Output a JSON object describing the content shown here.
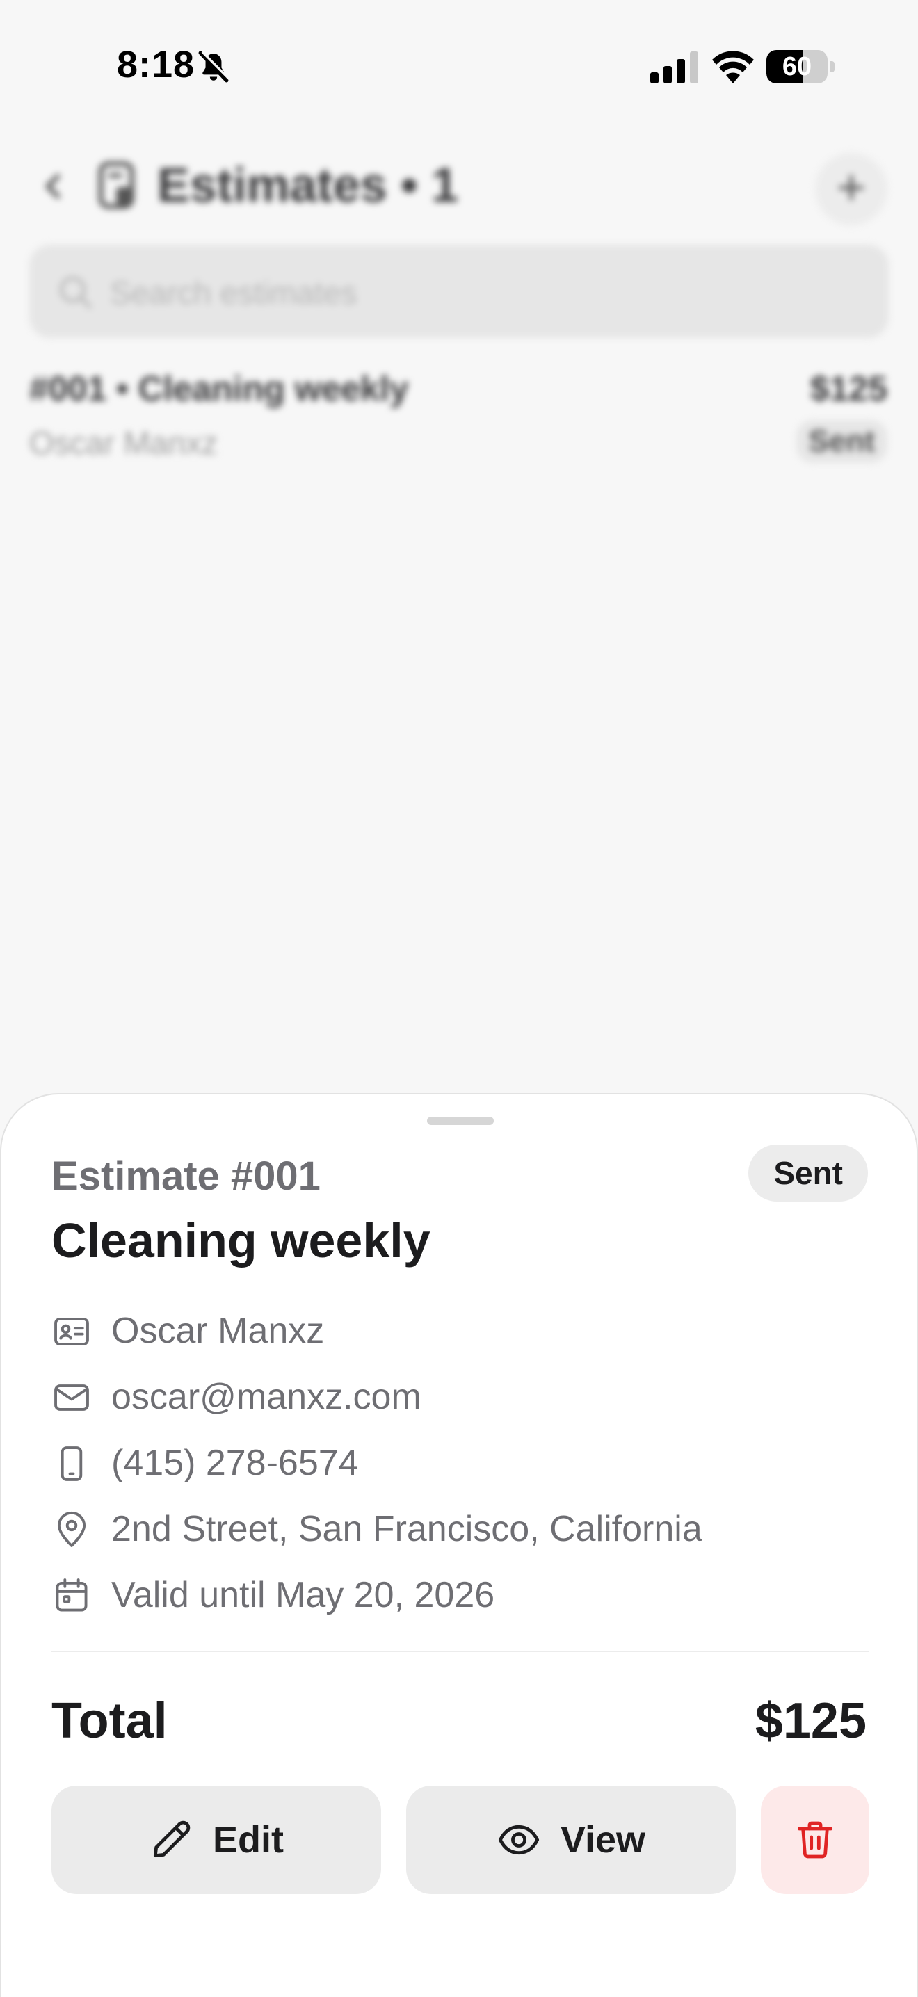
{
  "status_bar": {
    "time": "8:18",
    "battery": "60",
    "battery_level": 0.6
  },
  "background": {
    "header_title": "Estimates • 1",
    "search_placeholder": "Search estimates",
    "list": [
      {
        "title": "#001 • Cleaning weekly",
        "client": "Oscar Manxz",
        "amount": "$125",
        "status": "Sent"
      }
    ]
  },
  "sheet": {
    "estimate_number": "Estimate #001",
    "status": "Sent",
    "title": "Cleaning weekly",
    "details": {
      "client": "Oscar Manxz",
      "email": "oscar@manxz.com",
      "phone": "(415) 278-6574",
      "address": "2nd Street, San Francisco, California",
      "valid_until": "Valid until May 20, 2026"
    },
    "total_label": "Total",
    "total_value": "$125",
    "actions": {
      "edit": "Edit",
      "view": "View"
    }
  },
  "colors": {
    "delete_bg": "#fde9e9",
    "delete_icon": "#e02424",
    "pill_bg": "#ececec"
  },
  "icons": [
    "bell-slash-icon",
    "signal-icon",
    "wifi-icon",
    "battery-icon",
    "chevron-left-icon",
    "document-icon",
    "plus-icon",
    "search-icon",
    "contact-card-icon",
    "mail-icon",
    "phone-icon",
    "location-pin-icon",
    "calendar-icon",
    "pencil-icon",
    "eye-icon",
    "trash-icon"
  ]
}
